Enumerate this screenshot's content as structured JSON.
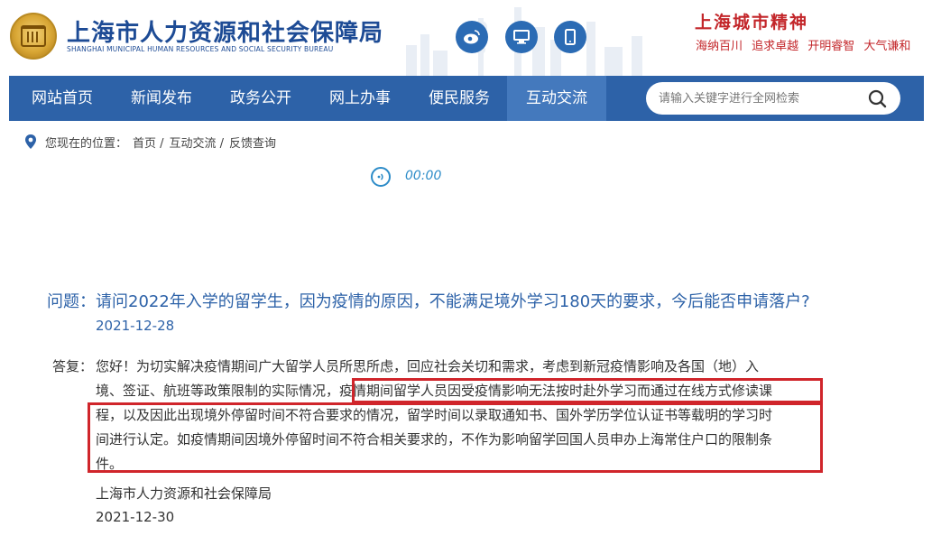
{
  "header": {
    "title": "上海市人力资源和社会保障局",
    "subtitle": "SHANGHAI MUNICIPAL HUMAN RESOURCES AND SOCIAL SECURITY BUREAU",
    "slogan_title": "上海城市精神",
    "slogan_items": "海纳百川 追求卓越 开明睿智 大气谦和",
    "social_icons": [
      "weibo-icon",
      "desktop-icon",
      "mobile-icon"
    ],
    "brand_color": "#1d4b95",
    "slogan_color": "#c3262a"
  },
  "nav": {
    "items": [
      {
        "label": "网站首页"
      },
      {
        "label": "新闻发布"
      },
      {
        "label": "政务公开"
      },
      {
        "label": "网上办事"
      },
      {
        "label": "便民服务"
      },
      {
        "label": "互动交流",
        "active": true
      }
    ],
    "search_placeholder": "请输入关键字进行全网检索",
    "bg_color": "#2d62a8"
  },
  "breadcrumb": {
    "prefix": "您现在的位置：",
    "items": [
      "首页 /",
      "互动交流 /",
      "反馈查询"
    ]
  },
  "audio": {
    "time": "00:00"
  },
  "question": {
    "label": "问题：",
    "text": "请问2022年入学的留学生，因为疫情的原因，不能满足境外学习180天的要求，今后能否申请落户?",
    "date": "2021-12-28"
  },
  "answer": {
    "label": "答复：",
    "lines": [
      "您好！为切实解决疫情期间广大留学人员所思所虑，回应社会关切和需求，考虑到新冠疫情影响及各国（地）入",
      "境、签证、航班等政策限制的实际情况，疫情期间留学人员因受疫情影响无法按时赴外学习而通过在线方式修读课",
      "程，以及因此出现境外停留时间不符合要求的情况，留学时间以录取通知书、国外学历学位认证书等载明的学习时",
      "间进行认定。如疫情期间因境外停留时间不符合相关要求的，不作为影响留学回国人员申办上海常住户口的限制条",
      "件。"
    ],
    "org": "上海市人力资源和社会保障局",
    "date": "2021-12-30",
    "highlight_color": "#d0252b"
  }
}
